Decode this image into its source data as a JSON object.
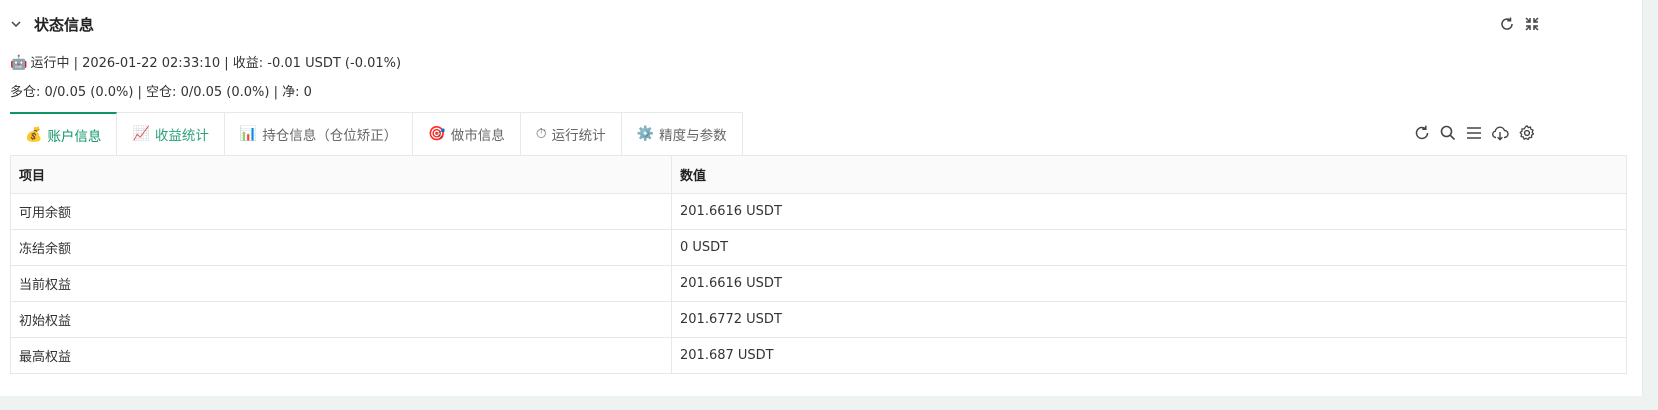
{
  "header": {
    "title": "状态信息"
  },
  "status": {
    "line1_emoji": "🤖",
    "line1": "运行中 | 2026-01-22 02:33:10 | 收益: -0.01 USDT (-0.01%)",
    "line2": "多仓: 0/0.05 (0.0%) | 空仓: 0/0.05 (0.0%) | 净: 0"
  },
  "tabs": [
    {
      "icon": "💰",
      "label": "账户信息"
    },
    {
      "icon": "📈",
      "label": "收益统计"
    },
    {
      "icon": "📊",
      "label": "持仓信息（仓位矫正）"
    },
    {
      "icon": "🎯",
      "label": "做市信息"
    },
    {
      "icon": "⏱",
      "label": "运行统计"
    },
    {
      "icon": "⚙️",
      "label": "精度与参数"
    }
  ],
  "table": {
    "columns": [
      "项目",
      "数值"
    ],
    "rows": [
      [
        "可用余额",
        "201.6616 USDT"
      ],
      [
        "冻结余额",
        "0 USDT"
      ],
      [
        "当前权益",
        "201.6616 USDT"
      ],
      [
        "初始权益",
        "201.6772 USDT"
      ],
      [
        "最高权益",
        "201.687 USDT"
      ]
    ]
  },
  "colors": {
    "accent": "#129469",
    "background": "#eef2f1"
  }
}
